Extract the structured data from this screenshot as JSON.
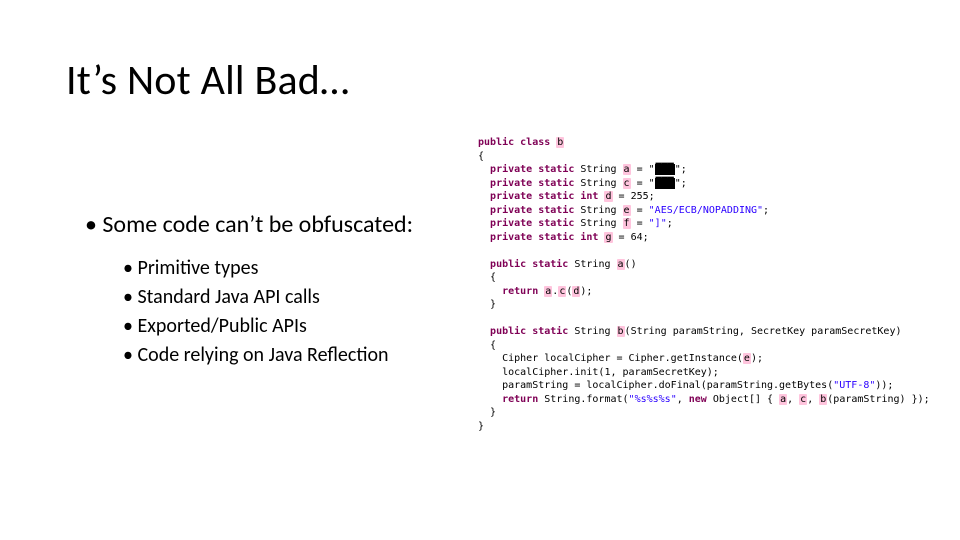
{
  "title": "It’s Not All Bad…",
  "lead": "Some code can’t be obfuscated:",
  "subs": [
    "Primitive types",
    "Standard Java API calls",
    "Exported/Public APIs",
    "Code relying on Java Reflection"
  ],
  "code": {
    "kw_public": "public",
    "kw_class": "class",
    "kw_private": "private",
    "kw_static": "static",
    "kw_int": "int",
    "kw_return": "return",
    "kw_new": "new",
    "type_string": "String",
    "type_secretkey": "SecretKey",
    "type_cipher": "Cipher",
    "type_object": "Object",
    "decl_open": "{",
    "decl_close": "}",
    "obf_cls": "b",
    "obf_f1": "a",
    "obf_f2": "c",
    "obf_f3": "d",
    "obf_f4": "e",
    "obf_f5": "f",
    "obf_f6": "g",
    "obf_m1": "a",
    "obf_m2": "b",
    "obf_p1": "a",
    "obf_p2": "c",
    "obf_arg": "d",
    "redact1": "███",
    "redact2": "███",
    "lit_255": "= 255;",
    "lit_64": "= 64;",
    "str_aes": "\"AES/ECB/NOPADDING\"",
    "str_brak": "\"]\"",
    "str_utf8": "\"UTF-8\"",
    "str_fmt": "\"%s%s%s\"",
    "eq_q_open": "= \"",
    "q_close_semi": "\";",
    "eq": "= ",
    "semi": ";",
    "paren_empty": "()",
    "call_getinstance": "Cipher localCipher = Cipher.getInstance(",
    "call_init": "localCipher.init(1, paramSecretKey);",
    "call_dofinal": "paramString = localCipher.doFinal(paramString.getBytes(",
    "call_format": "String.format(",
    "sig2_params": "(String paramString, SecretKey paramSecretKey)",
    "comma_sp": ", ",
    "dot": ".",
    "paren_open": "(",
    "paren_close": ")",
    "close_paren_semi": ");",
    "close_paren2_semi": "));",
    "arr_open": "[] { ",
    "brace_close_paren_semi": " });",
    "return_sp": " ",
    "paramstring_paren": "(paramString)"
  }
}
